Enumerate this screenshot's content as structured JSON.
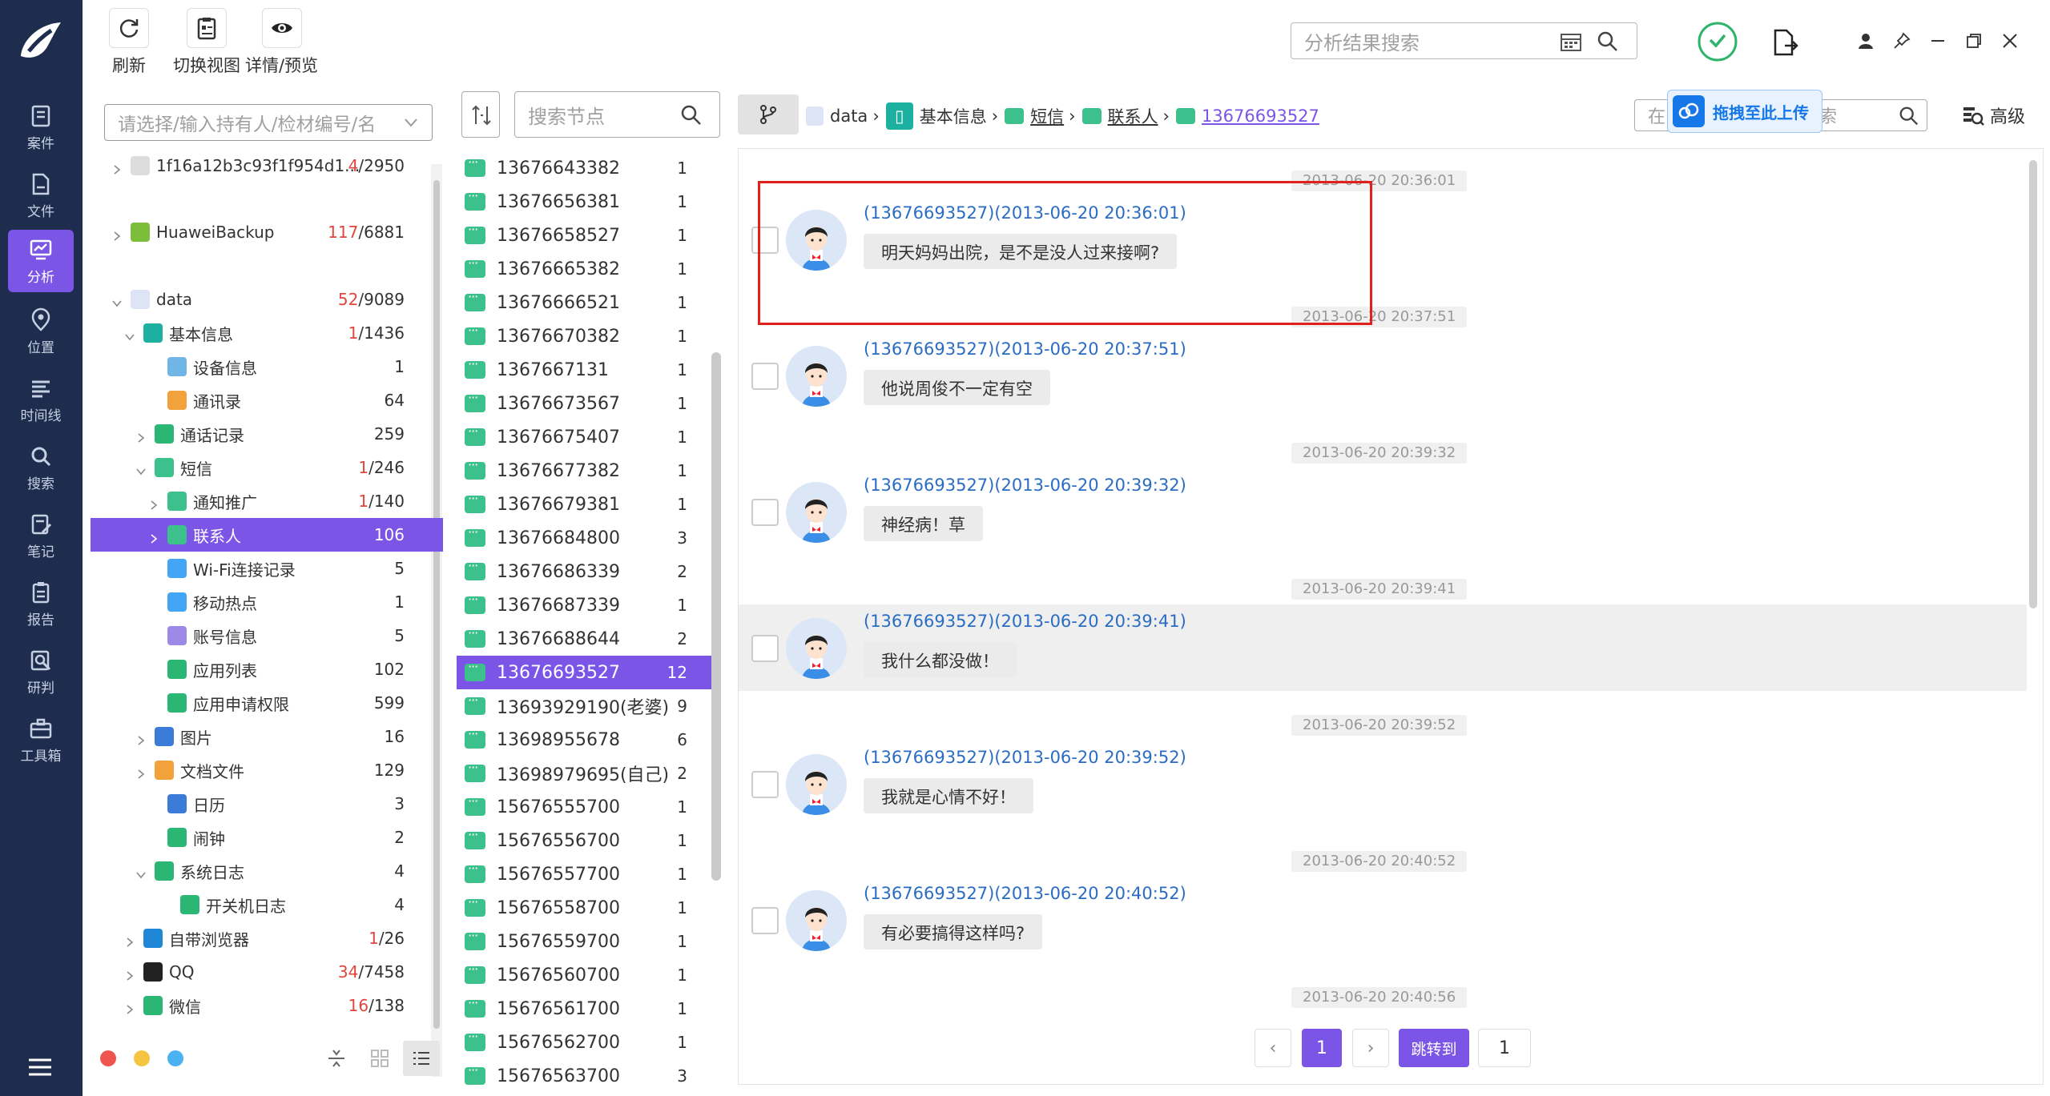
{
  "nav": {
    "items": [
      {
        "label": "案件",
        "icon": "case-icon"
      },
      {
        "label": "文件",
        "icon": "file-icon"
      },
      {
        "label": "分析",
        "icon": "analysis-icon"
      },
      {
        "label": "位置",
        "icon": "location-icon"
      },
      {
        "label": "时间线",
        "icon": "timeline-icon"
      },
      {
        "label": "搜索",
        "icon": "search-icon"
      },
      {
        "label": "笔记",
        "icon": "note-icon"
      },
      {
        "label": "报告",
        "icon": "report-icon"
      },
      {
        "label": "研判",
        "icon": "judge-icon"
      },
      {
        "label": "工具箱",
        "icon": "toolbox-icon"
      }
    ],
    "active_index": 2
  },
  "toolbar": {
    "refresh": "刷新",
    "switch_view": "切换视图",
    "detail_preview": "详情/预览"
  },
  "top_search": {
    "placeholder": "分析结果搜索"
  },
  "tree_search": {
    "placeholder": "请选择/输入持有人/检材编号/名"
  },
  "node_search": {
    "placeholder": "搜索节点"
  },
  "tree": [
    {
      "label": "1f16a12b3c93f1f954d1...",
      "red": "4",
      "total": "/2950"
    },
    {
      "label": "HuaweiBackup",
      "red": "117",
      "total": "/6881"
    },
    {
      "label": "data",
      "red": "52",
      "total": "/9089"
    },
    {
      "label": "基本信息",
      "red": "1",
      "total": "/1436"
    },
    {
      "label": "设备信息",
      "red": "",
      "total": "1"
    },
    {
      "label": "通讯录",
      "red": "",
      "total": "64"
    },
    {
      "label": "通话记录",
      "red": "",
      "total": "259"
    },
    {
      "label": "短信",
      "red": "1",
      "total": "/246"
    },
    {
      "label": "通知推广",
      "red": "1",
      "total": "/140"
    },
    {
      "label": "联系人",
      "red": "",
      "total": "106"
    },
    {
      "label": "Wi-Fi连接记录",
      "red": "",
      "total": "5"
    },
    {
      "label": "移动热点",
      "red": "",
      "total": "1"
    },
    {
      "label": "账号信息",
      "red": "",
      "total": "5"
    },
    {
      "label": "应用列表",
      "red": "",
      "total": "102"
    },
    {
      "label": "应用申请权限",
      "red": "",
      "total": "599"
    },
    {
      "label": "图片",
      "red": "",
      "total": "16"
    },
    {
      "label": "文档文件",
      "red": "",
      "total": "129"
    },
    {
      "label": "日历",
      "red": "",
      "total": "3"
    },
    {
      "label": "闹钟",
      "red": "",
      "total": "2"
    },
    {
      "label": "系统日志",
      "red": "",
      "total": "4"
    },
    {
      "label": "开关机日志",
      "red": "",
      "total": "4"
    },
    {
      "label": "自带浏览器",
      "red": "1",
      "total": "/26"
    },
    {
      "label": "QQ",
      "red": "34",
      "total": "/7458"
    },
    {
      "label": "微信",
      "red": "16",
      "total": "/138"
    }
  ],
  "contacts": [
    {
      "num": "13676643382",
      "count": "1"
    },
    {
      "num": "13676656381",
      "count": "1"
    },
    {
      "num": "13676658527",
      "count": "1"
    },
    {
      "num": "13676665382",
      "count": "1"
    },
    {
      "num": "13676666521",
      "count": "1"
    },
    {
      "num": "13676670382",
      "count": "1"
    },
    {
      "num": "1367667131",
      "count": "1"
    },
    {
      "num": "13676673567",
      "count": "1"
    },
    {
      "num": "13676675407",
      "count": "1"
    },
    {
      "num": "13676677382",
      "count": "1"
    },
    {
      "num": "13676679381",
      "count": "1"
    },
    {
      "num": "13676684800",
      "count": "3"
    },
    {
      "num": "13676686339",
      "count": "2"
    },
    {
      "num": "13676687339",
      "count": "1"
    },
    {
      "num": "13676688644",
      "count": "2"
    },
    {
      "num": "13676693527",
      "count": "12"
    },
    {
      "num": "13693929190(老婆)",
      "count": "9"
    },
    {
      "num": "13698955678",
      "count": "6"
    },
    {
      "num": "13698979695(自己)",
      "count": "2"
    },
    {
      "num": "15676555700",
      "count": "1"
    },
    {
      "num": "15676556700",
      "count": "1"
    },
    {
      "num": "15676557700",
      "count": "1"
    },
    {
      "num": "15676558700",
      "count": "1"
    },
    {
      "num": "15676559700",
      "count": "1"
    },
    {
      "num": "15676560700",
      "count": "1"
    },
    {
      "num": "15676561700",
      "count": "1"
    },
    {
      "num": "15676562700",
      "count": "1"
    },
    {
      "num": "15676563700",
      "count": "3"
    }
  ],
  "breadcrumb": [
    "data",
    "基本信息",
    "短信",
    "联系人",
    "13676693527"
  ],
  "upload_badge": "拖拽至此上传",
  "in_result_search": {
    "placeholder": "在",
    "placeholder2": "搜索"
  },
  "advanced": "高级",
  "messages": [
    {
      "ts": "2013-06-20 20:36:01",
      "sender": "(13676693527)(2013-06-20 20:36:01)",
      "text": "明天妈妈出院，是不是没人过来接啊?"
    },
    {
      "ts": "2013-06-20 20:37:51",
      "sender": "(13676693527)(2013-06-20 20:37:51)",
      "text": "他说周俊不一定有空"
    },
    {
      "ts": "2013-06-20 20:39:32",
      "sender": "(13676693527)(2013-06-20 20:39:32)",
      "text": "神经病！草"
    },
    {
      "ts": "2013-06-20 20:39:41",
      "sender": "(13676693527)(2013-06-20 20:39:41)",
      "text": "我什么都没做！"
    },
    {
      "ts": "2013-06-20 20:39:52",
      "sender": "(13676693527)(2013-06-20 20:39:52)",
      "text": "我就是心情不好！"
    },
    {
      "ts": "2013-06-20 20:40:52",
      "sender": "(13676693527)(2013-06-20 20:40:52)",
      "text": "有必要搞得这样吗?"
    },
    {
      "ts": "2013-06-20 20:40:56",
      "sender": "",
      "text": ""
    }
  ],
  "pagination": {
    "current": "1",
    "jump_label": "跳转到",
    "jump_value": "1"
  },
  "colors": {
    "accent": "#7b55e6",
    "nav_bg": "#1e2d4d",
    "highlight_box": "#e0201b",
    "msg_icon": "#3cc08c"
  }
}
